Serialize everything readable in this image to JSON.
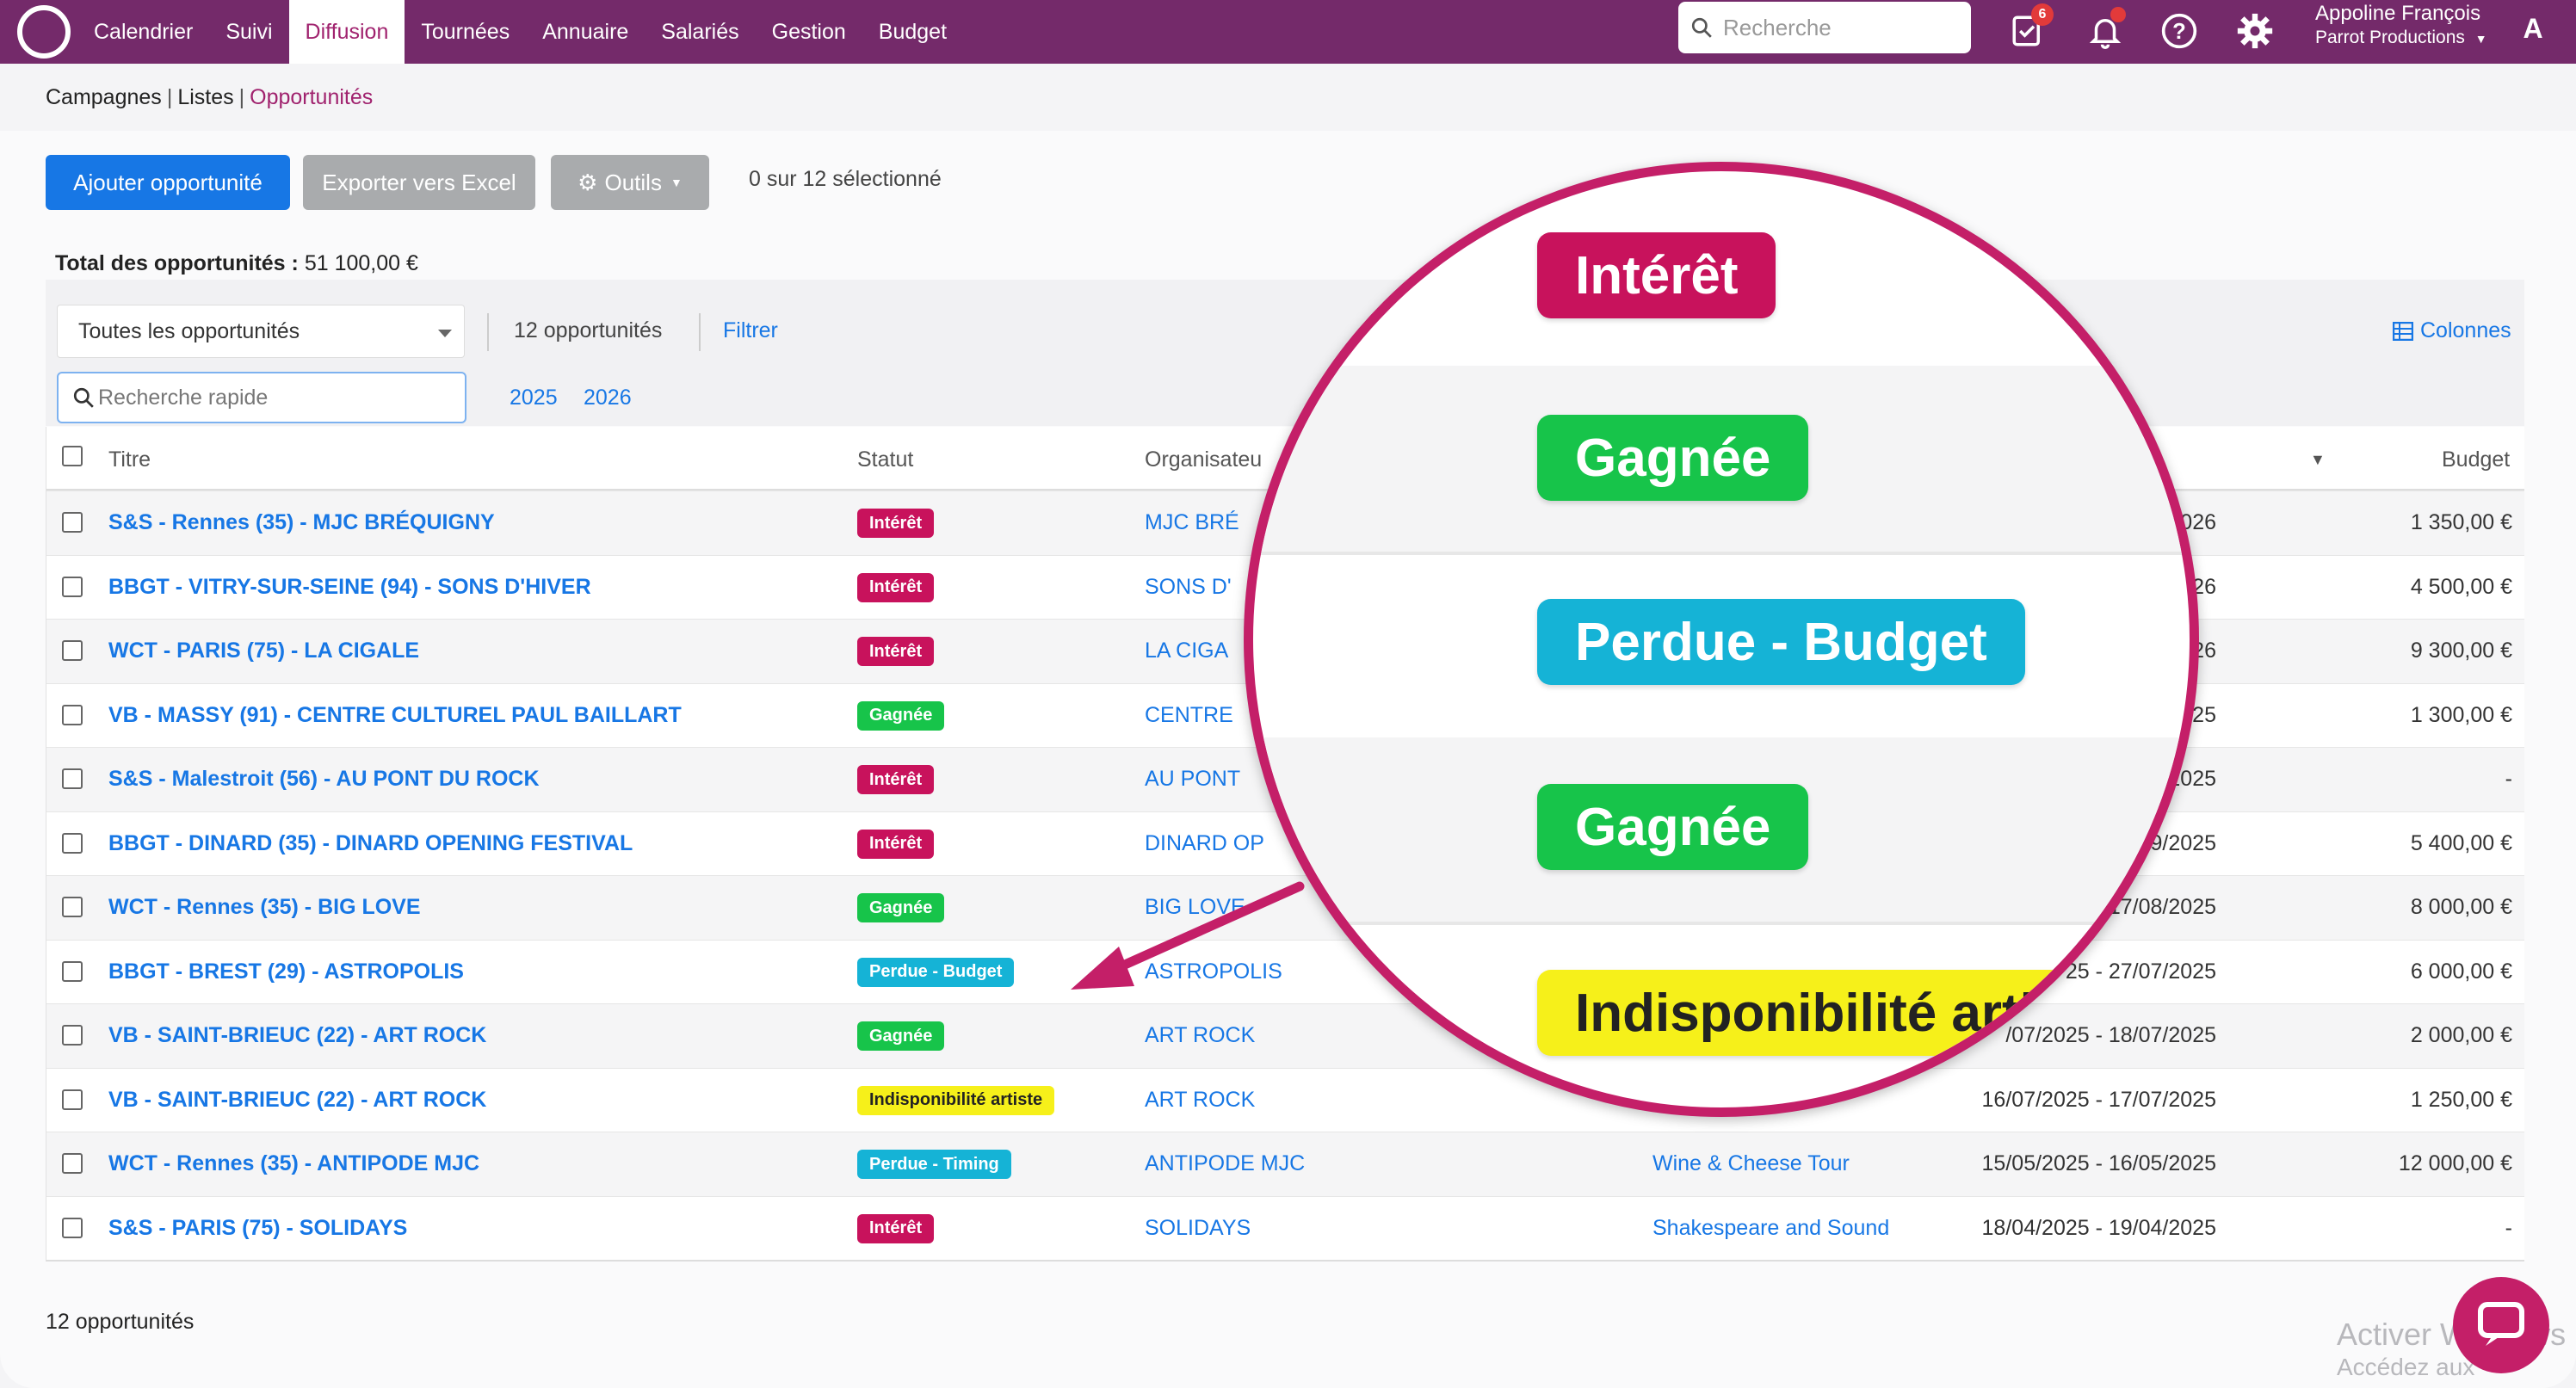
{
  "navbar": {
    "items": [
      "Calendrier",
      "Suivi",
      "Diffusion",
      "Tournées",
      "Annuaire",
      "Salariés",
      "Gestion",
      "Budget"
    ],
    "active": "Diffusion",
    "search_placeholder": "Recherche",
    "tasks_badge": "6",
    "user_name": "Appoline François",
    "user_org": "Parrot Productions",
    "avatar_initial": "A",
    "bg_color": "#742a6a"
  },
  "breadcrumb": {
    "item1": "Campagnes",
    "item2": "Listes",
    "item3": "Opportunités",
    "sep": "|"
  },
  "toolbar": {
    "add_label": "Ajouter opportunité",
    "export_label": "Exporter vers Excel",
    "tools_label": "Outils",
    "selection": "0 sur 12 sélectionné"
  },
  "total": {
    "label": "Total des opportunités :",
    "value": "51 100,00 €"
  },
  "filters": {
    "select_value": "Toutes les opportunités",
    "count": "12 opportunités",
    "filter_label": "Filtrer",
    "columns_label": "Colonnes",
    "quick_search_placeholder": "Recherche rapide",
    "years": [
      "2025",
      "2026"
    ]
  },
  "table": {
    "headers": {
      "title": "Titre",
      "status": "Statut",
      "organiser": "Organisateu",
      "budget": "Budget"
    },
    "rows": [
      {
        "title": "S&S - Rennes (35) - MJC BRÉQUIGNY",
        "status": "Intérêt",
        "status_type": "interet",
        "org": "MJC BRÉ",
        "tour": "",
        "dates": "/2026",
        "budget": "1 350,00 €"
      },
      {
        "title": "BBGT - VITRY-SUR-SEINE (94) - SONS D'HIVER",
        "status": "Intérêt",
        "status_type": "interet",
        "org": "SONS D'",
        "tour": "",
        "dates": "026",
        "budget": "4 500,00 €"
      },
      {
        "title": "WCT - PARIS (75) - LA CIGALE",
        "status": "Intérêt",
        "status_type": "interet",
        "org": "LA CIGA",
        "tour": "",
        "dates": "026",
        "budget": "9 300,00 €"
      },
      {
        "title": "VB - MASSY (91) - CENTRE CULTUREL PAUL BAILLART",
        "status": "Gagnée",
        "status_type": "gagnee",
        "org": "CENTRE",
        "tour": "",
        "dates": "025",
        "budget": "1 300,00 €"
      },
      {
        "title": "S&S - Malestroit (56) - AU PONT DU ROCK",
        "status": "Intérêt",
        "status_type": "interet",
        "org": "AU PONT",
        "tour": "",
        "dates": "/2025",
        "budget": "-"
      },
      {
        "title": "BBGT - DINARD (35) - DINARD OPENING FESTIVAL",
        "status": "Intérêt",
        "status_type": "interet",
        "org": "DINARD OP",
        "tour": "",
        "dates": "09/2025",
        "budget": "5 400,00 €"
      },
      {
        "title": "WCT - Rennes (35) - BIG LOVE",
        "status": "Gagnée",
        "status_type": "gagnee",
        "org": "BIG LOVE",
        "tour": "",
        "dates": "17/08/2025",
        "budget": "8 000,00 €"
      },
      {
        "title": "BBGT - BREST (29) - ASTROPOLIS",
        "status": "Perdue - Budget",
        "status_type": "perdue",
        "org": "ASTROPOLIS",
        "tour": "",
        "dates": "25 - 27/07/2025",
        "budget": "6 000,00 €"
      },
      {
        "title": "VB - SAINT-BRIEUC (22) - ART ROCK",
        "status": "Gagnée",
        "status_type": "gagnee",
        "org": "ART ROCK",
        "tour": "",
        "dates": "/07/2025 - 18/07/2025",
        "budget": "2 000,00 €"
      },
      {
        "title": "VB - SAINT-BRIEUC (22) - ART ROCK",
        "status": "Indisponibilité artiste",
        "status_type": "indispo",
        "org": "ART ROCK",
        "tour": "",
        "dates": "16/07/2025 - 17/07/2025",
        "budget": "1 250,00 €"
      },
      {
        "title": "WCT - Rennes (35) - ANTIPODE MJC",
        "status": "Perdue - Timing",
        "status_type": "perdue",
        "org": "ANTIPODE MJC",
        "tour": "Wine & Cheese Tour",
        "dates": "15/05/2025 - 16/05/2025",
        "budget": "12 000,00 €"
      },
      {
        "title": "S&S - PARIS (75) - SOLIDAYS",
        "status": "Intérêt",
        "status_type": "interet",
        "org": "SOLIDAYS",
        "tour": "Shakespeare and Sound",
        "dates": "18/04/2025 - 19/04/2025",
        "budget": "-"
      }
    ]
  },
  "footer": {
    "count": "12 opportunités"
  },
  "zoom": {
    "pills": [
      {
        "label": "Intérêt",
        "type": "interet"
      },
      {
        "label": "Gagnée",
        "type": "gagnee"
      },
      {
        "label": "Perdue - Budget",
        "type": "perdue"
      },
      {
        "label": "Gagnée",
        "type": "gagnee"
      },
      {
        "label": "Indisponibilité artiste",
        "type": "indispo"
      }
    ],
    "border_color": "#c41f68"
  },
  "watermark": {
    "line1": "Activer Windows",
    "line2": "Accédez aux paramètres"
  },
  "colors": {
    "interet": "#c8125c",
    "gagnee": "#17c44a",
    "perdue": "#15b3d6",
    "indispo": "#f6f01a",
    "link": "#1777e5"
  }
}
